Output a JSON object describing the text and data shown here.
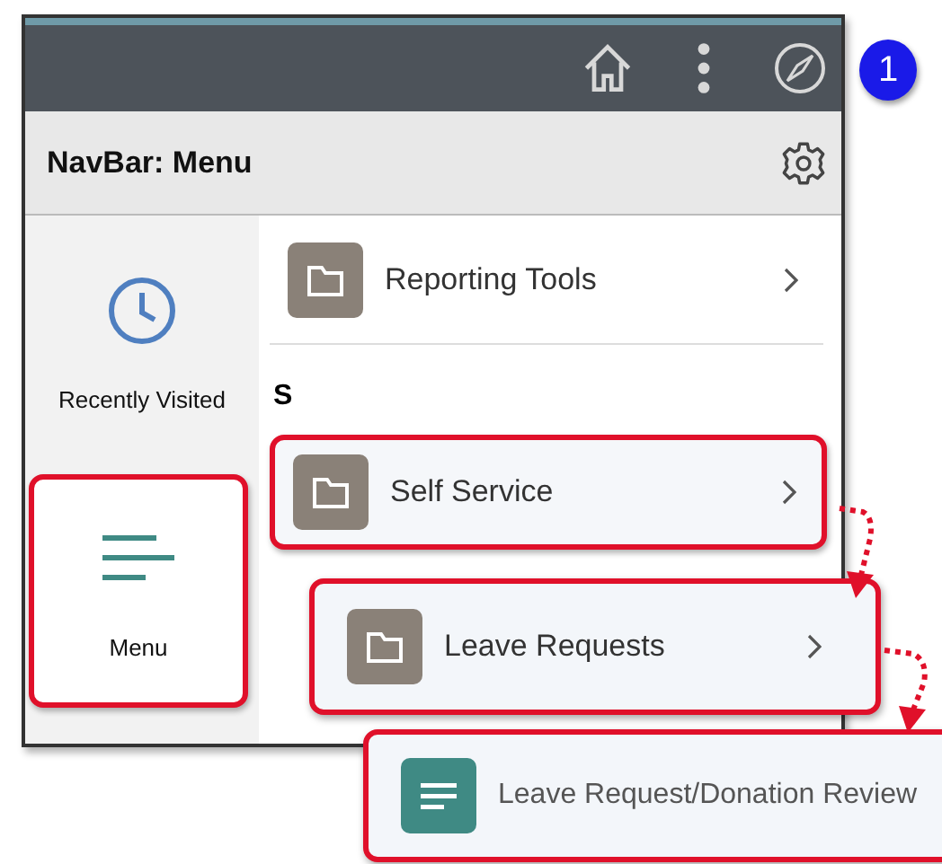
{
  "topbar": {
    "buttons": [
      {
        "kind": "home"
      },
      {
        "kind": "more"
      },
      {
        "kind": "compass"
      }
    ],
    "callout": "1"
  },
  "panel": {
    "title": "NavBar: Menu"
  },
  "sidebar": {
    "items": [
      {
        "kind": "clock",
        "label": "Recently Visited",
        "selected": false,
        "highlighted": false
      },
      {
        "kind": "menu",
        "label": "Menu",
        "selected": true,
        "highlighted": true
      }
    ]
  },
  "menu": {
    "items": [
      {
        "kind": "folder",
        "label": "Reporting Tools",
        "highlighted": false
      },
      {
        "kind": "section",
        "label": "S"
      },
      {
        "kind": "folder",
        "label": "Self Service",
        "highlighted": true
      }
    ]
  },
  "flyouts": [
    {
      "kind": "folder",
      "label": "Leave Requests",
      "highlighted": true
    },
    {
      "kind": "page",
      "label": "Leave Request/Donation Review",
      "highlighted": true
    }
  ]
}
